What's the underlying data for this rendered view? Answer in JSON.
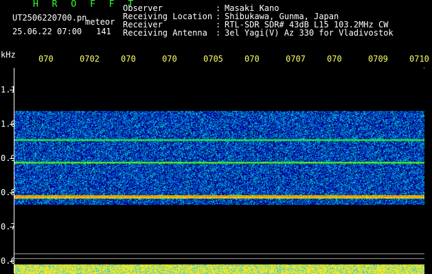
{
  "header": {
    "station_code": "H R O F F T",
    "file_name": "UT2506220700.pn",
    "detector_label": "meteor",
    "date_time": "25.06.22 07:00",
    "count": "141"
  },
  "info": [
    {
      "label": "Observer",
      "value": "Masaki Kano"
    },
    {
      "label": "Receiving Location",
      "value": "Shibukawa, Gunma, Japan"
    },
    {
      "label": "Receiver",
      "value": "RTL-SDR SDR# 43dB L15 103.2MHz CW"
    },
    {
      "label": "Receiving Antenna",
      "value": "3el Yagi(V) Az 330 for Vladivostok"
    }
  ],
  "y_axis": {
    "unit": "kHz",
    "ticks": [
      "1.1",
      "1.0",
      "0.9",
      "0.8",
      "0.7",
      "0.6"
    ]
  },
  "time_axis": {
    "labels": [
      "070",
      "0702",
      "070",
      "070",
      "0705",
      "070",
      "0707",
      "070",
      "0709",
      "0710"
    ]
  },
  "colors": {
    "background": "#000000",
    "header_green": "#33ff33",
    "time_label_yellow": "#ffff66",
    "text_white": "#ffffff"
  }
}
